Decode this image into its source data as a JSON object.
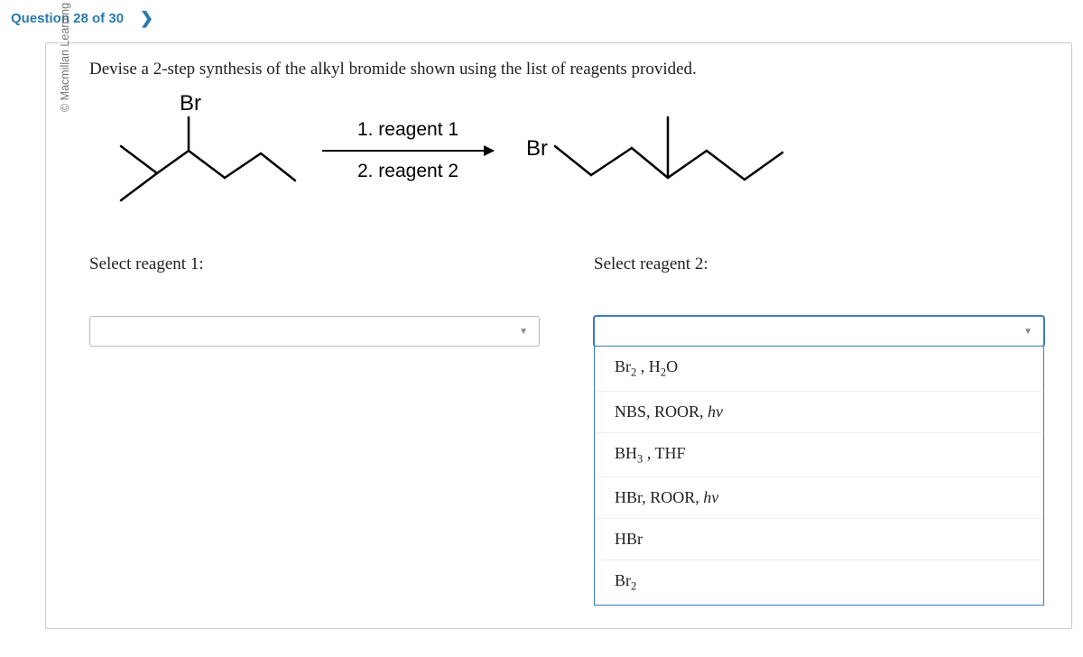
{
  "header": {
    "question_label": "Question 28 of 30"
  },
  "copyright": "© Macmillan Learning",
  "prompt": "Devise a 2-step synthesis of the alkyl bromide shown using the list of reagents provided.",
  "scheme": {
    "start_label": "Br",
    "reagent1_line": "1. reagent 1",
    "reagent2_line": "2. reagent 2",
    "product_label": "Br"
  },
  "select1": {
    "label": "Select reagent 1:"
  },
  "select2": {
    "label": "Select reagent 2:",
    "options": [
      "Br₂ , H₂O",
      "NBS, ROOR, hv",
      "BH₃ , THF",
      "HBr, ROOR, hv",
      "HBr",
      "Br₂"
    ]
  }
}
